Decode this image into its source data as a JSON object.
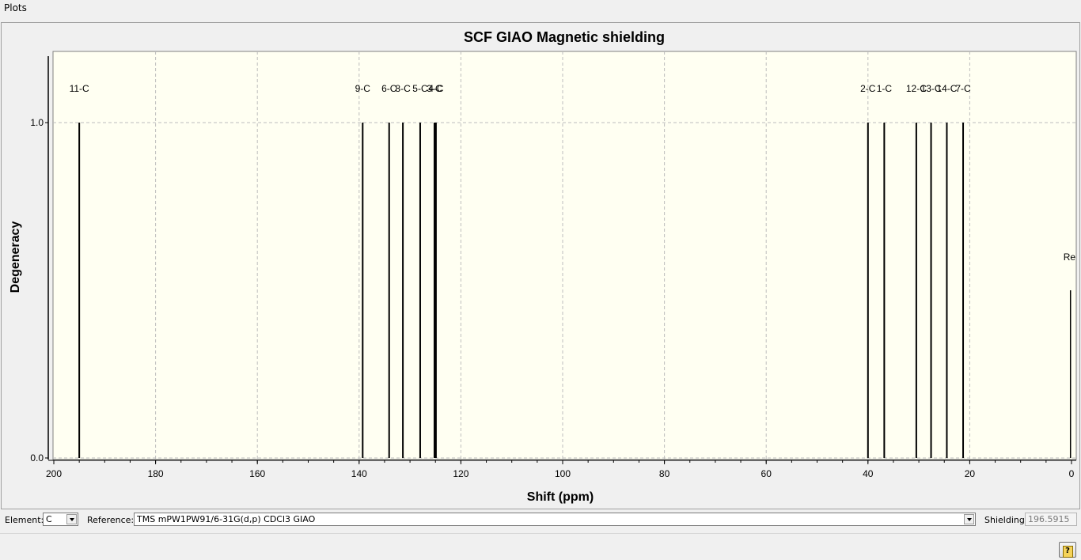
{
  "menu": {
    "plots_label": "Plots"
  },
  "chart_data": {
    "type": "bar",
    "title": "SCF GIAO Magnetic shielding",
    "xlabel": "Shift (ppm)",
    "ylabel": "Degeneracy",
    "xlim": [
      200,
      0
    ],
    "ylim": [
      0,
      1.0
    ],
    "x_ticks": [
      "200",
      "180",
      "160",
      "140",
      "120",
      "100",
      "80",
      "60",
      "40",
      "20",
      "0"
    ],
    "y_ticks": [
      "0.0",
      "1.0"
    ],
    "grid": true,
    "peaks": [
      {
        "label": "11-C",
        "shift": 195.0,
        "degeneracy": 1.0
      },
      {
        "label": "9-C",
        "shift": 139.3,
        "degeneracy": 1.0
      },
      {
        "label": "6-C",
        "shift": 134.1,
        "degeneracy": 1.0
      },
      {
        "label": "8-C",
        "shift": 131.4,
        "degeneracy": 1.0
      },
      {
        "label": "5-C",
        "shift": 128.0,
        "degeneracy": 1.0
      },
      {
        "label": "3-C",
        "shift": 125.2,
        "degeneracy": 1.0
      },
      {
        "label": "4-C",
        "shift": 124.9,
        "degeneracy": 1.0
      },
      {
        "label": "2-C",
        "shift": 40.0,
        "degeneracy": 1.0
      },
      {
        "label": "1-C",
        "shift": 36.8,
        "degeneracy": 1.0
      },
      {
        "label": "12-C",
        "shift": 30.5,
        "degeneracy": 1.0
      },
      {
        "label": "13-C",
        "shift": 27.6,
        "degeneracy": 1.0
      },
      {
        "label": "14-C",
        "shift": 24.5,
        "degeneracy": 1.0
      },
      {
        "label": "7-C",
        "shift": 21.3,
        "degeneracy": 1.0
      }
    ],
    "reference_marker": {
      "label": "Re",
      "shift": 0.2,
      "degeneracy": 0.5
    }
  },
  "controls": {
    "element_label": "Element:",
    "element_value": "C",
    "reference_label": "Reference:",
    "reference_value": "TMS mPW1PW91/6-31G(d,p) CDCl3 GIAO",
    "shielding_label": "Shielding:",
    "shielding_value": "196.5915"
  },
  "help": {
    "icon": "help-icon",
    "glyph": "?"
  }
}
